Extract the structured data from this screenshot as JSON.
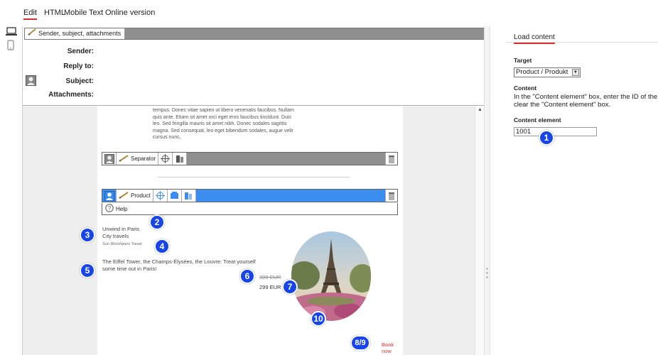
{
  "nav": {
    "items": [
      "Edit",
      "HTML",
      "Mobile",
      "Text",
      "Online version"
    ]
  },
  "header": {
    "tab_label": "Sender, subject, attachments",
    "fields": [
      "Sender:",
      "Reply to:",
      "Subject:",
      "Attachments:"
    ]
  },
  "content": {
    "lorem": "tempus. Donec vitae sapien ut libero venenatis faucibus. Nullam quis ante. Etiam sit amet orci eget eros faucibus tincidunt. Duis leo. Sed fringilla mauris sit amet nibh. Donec sodales sagittis magna. Sed consequat, leo eget bibendum sodales, augue velit cursus nunc,",
    "separator_label": "Separator",
    "product_label": "Product",
    "help_label": "Help",
    "product": {
      "title": "Unwind in Paris",
      "subtitle": "City travels",
      "brand": "Sun Worshipers Travel",
      "description": "The Eiffel Tower, the Champs-Élysées, the Louvre: Treat yourself some time out in Paris!",
      "old_price": "399 EUR",
      "price": "299 EUR",
      "cta": "Book now"
    }
  },
  "badges": [
    "1",
    "2",
    "3",
    "4",
    "5",
    "6",
    "7",
    "8/9",
    "10"
  ],
  "right_panel": {
    "tab": "Load content",
    "target_heading": "Target",
    "target_value": "Product / Produkt",
    "content_heading": "Content",
    "content_text_1": "In the \"Content element\" box, enter the ID of the co",
    "content_text_2": "clear the \"Content element\" box.",
    "element_heading": "Content element",
    "element_value": "1001"
  },
  "colors": {
    "accent_red": "#d6302f",
    "badge_blue": "#1745e8",
    "product_bar": "#3b8df0"
  }
}
